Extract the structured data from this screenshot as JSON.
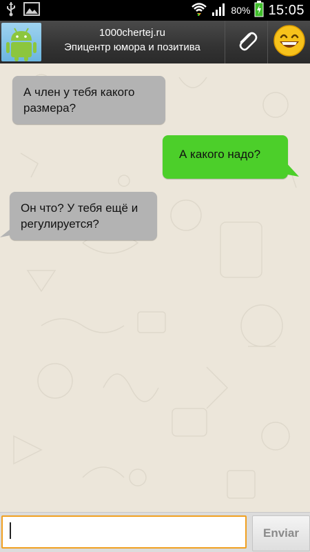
{
  "status_bar": {
    "battery_percent": "80%",
    "time": "15:05",
    "icons": [
      "usb-icon",
      "gallery-icon",
      "wifi-icon",
      "signal-icon",
      "battery-icon"
    ]
  },
  "header": {
    "title": "1000chertej.ru",
    "subtitle": "Эпицентр юмора и позитива",
    "avatar_icon": "android-robot-icon",
    "attach_icon": "paperclip-icon",
    "smiley_icon": "smiley-icon"
  },
  "messages": [
    {
      "direction": "incoming",
      "text_line1": "А член у тебя какого",
      "text_line2": "размера?"
    },
    {
      "direction": "outgoing",
      "text_line1": "А какого надо?"
    },
    {
      "direction": "incoming",
      "text_line1": "Он что? У тебя ещё и",
      "text_line2": "регулируется?"
    }
  ],
  "composer": {
    "input_value": "",
    "send_label": "Enviar"
  },
  "colors": {
    "incoming_bubble": "#b3b3b3",
    "outgoing_bubble": "#4ccf2a",
    "chat_background": "#ece6da",
    "input_border": "#f0a020"
  }
}
